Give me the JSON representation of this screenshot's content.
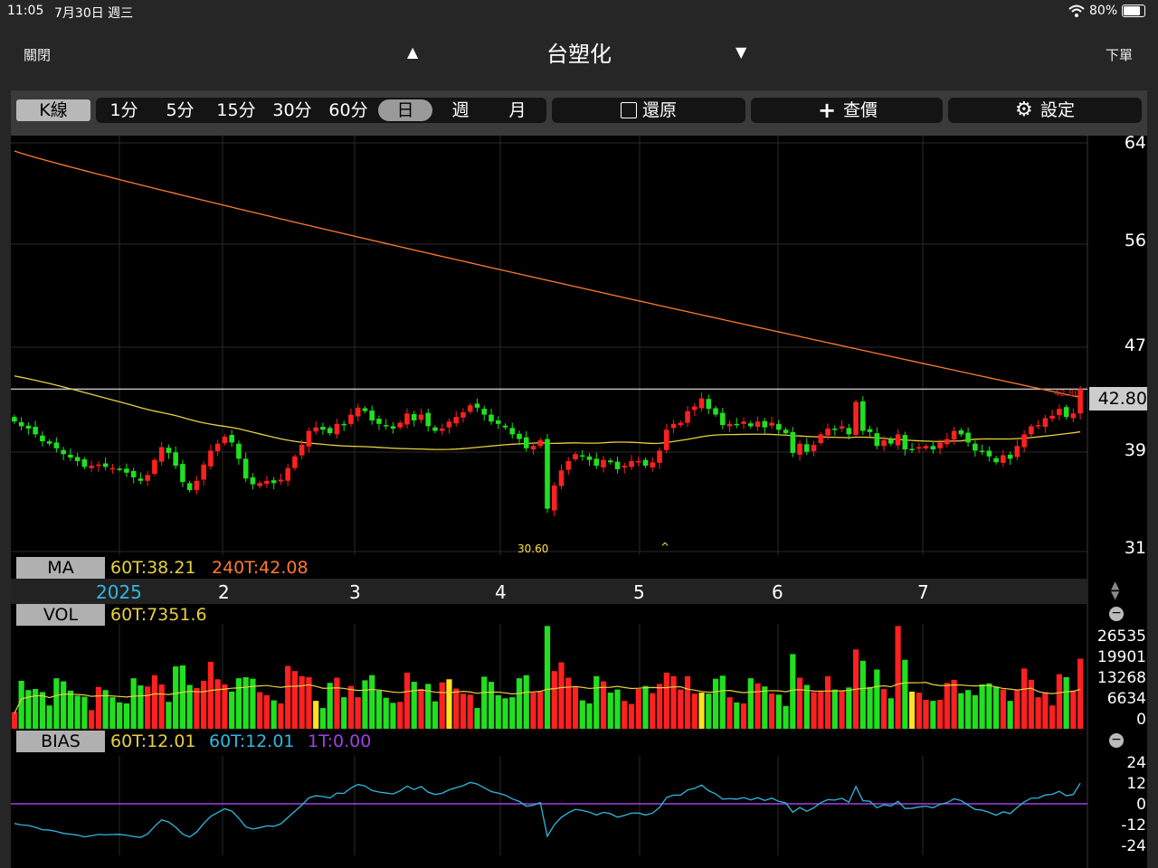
{
  "status": {
    "time": "11:05",
    "date": "7月30日 週三",
    "battery": "80%"
  },
  "nav": {
    "close": "關閉",
    "title": "台塑化",
    "order": "下單"
  },
  "toolbar": {
    "kline": "K線",
    "periods": [
      "1分",
      "5分",
      "15分",
      "30分",
      "60分",
      "日",
      "週",
      "月"
    ],
    "selected_period": "日",
    "restore": "還原",
    "price_lookup": "查價",
    "settings": "設定"
  },
  "ma_panel": {
    "label": "MA",
    "ma60": "60T:38.21",
    "ma240": "240T:42.08",
    "y_ticks": [
      "64",
      "56",
      "47",
      "39",
      "31"
    ],
    "current_price": "42.80",
    "last_marker": "42.80",
    "low_label": "30.60"
  },
  "x_axis": {
    "ticks": [
      "2025",
      "2",
      "3",
      "4",
      "5",
      "6",
      "7"
    ]
  },
  "vol_panel": {
    "label": "VOL",
    "ma60": "60T:7351.6",
    "y_ticks": [
      "26535",
      "19901",
      "13268",
      "6634",
      "0"
    ]
  },
  "bias_panel": {
    "label": "BIAS",
    "b1": "60T:12.01",
    "b2": "60T:12.01",
    "b3": "1T:0.00",
    "y_ticks": [
      "24",
      "12",
      "0",
      "-12",
      "-24"
    ]
  },
  "colors": {
    "up": "#ff2020",
    "down": "#20e020",
    "ma60": "#e8d040",
    "ma240": "#ff7a30",
    "bias2": "#30b8e0",
    "bias3": "#a040e0"
  },
  "chart_data": {
    "type": "candlestick",
    "ylim": [
      31,
      64
    ],
    "closes": [
      40.0,
      39.6,
      39.4,
      38.9,
      38.3,
      38.1,
      37.7,
      37.2,
      36.9,
      36.6,
      36.1,
      36.2,
      36.3,
      36.1,
      36.0,
      35.9,
      35.6,
      35.2,
      34.9,
      35.4,
      36.7,
      37.8,
      37.3,
      36.2,
      34.8,
      34.1,
      34.9,
      36.3,
      37.5,
      38.1,
      38.7,
      38.2,
      36.8,
      35.1,
      34.6,
      34.7,
      34.9,
      34.7,
      35.0,
      36.0,
      37.0,
      38.0,
      39.2,
      39.5,
      39.3,
      39.0,
      39.8,
      39.7,
      40.6,
      41.2,
      40.9,
      40.1,
      39.8,
      39.6,
      39.4,
      39.9,
      40.7,
      40.1,
      40.6,
      39.6,
      39.2,
      39.4,
      40.0,
      40.4,
      40.8,
      41.4,
      41.2,
      40.6,
      40.0,
      39.8,
      39.5,
      38.9,
      38.5,
      37.7,
      37.9,
      38.4,
      32.5,
      34.5,
      35.8,
      36.6,
      37.2,
      37.0,
      36.7,
      36.2,
      36.7,
      36.5,
      35.9,
      36.2,
      36.6,
      36.6,
      36.2,
      36.5,
      37.5,
      39.3,
      39.8,
      39.9,
      40.9,
      41.3,
      42.0,
      41.1,
      40.6,
      39.7,
      39.8,
      39.7,
      40.0,
      39.6,
      40.0,
      39.5,
      39.9,
      39.3,
      39.0,
      37.3,
      38.1,
      37.4,
      38.0,
      38.9,
      39.4,
      39.3,
      39.6,
      38.9,
      41.7,
      39.2,
      39.1,
      37.9,
      38.4,
      38.1,
      38.9,
      37.6,
      37.6,
      37.8,
      37.9,
      37.6,
      38.2,
      38.5,
      39.2,
      38.9,
      38.2,
      37.5,
      37.4,
      37.0,
      36.5,
      37.1,
      36.8,
      37.9,
      38.9,
      39.6,
      39.7,
      40.3,
      40.5,
      41.1,
      40.4,
      40.7,
      42.8
    ]
  }
}
